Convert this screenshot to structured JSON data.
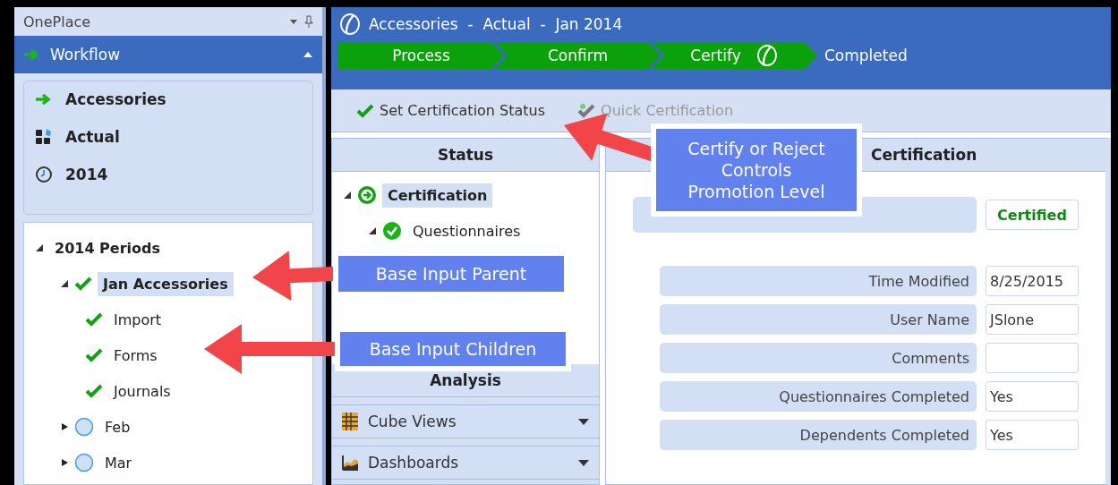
{
  "sidebar": {
    "title": "OnePlace",
    "workflow": {
      "label": "Workflow",
      "expanded": true
    },
    "pov": [
      {
        "kind": "workflow",
        "label": "Accessories"
      },
      {
        "kind": "scenario",
        "label": "Actual"
      },
      {
        "kind": "time",
        "label": "2014"
      }
    ],
    "periods": [
      {
        "label": "2014 Periods",
        "expanded": true,
        "selected": false,
        "children": [
          {
            "label": "Jan Accessories",
            "complete": true,
            "expanded": true,
            "selected": true,
            "children": [
              {
                "label": "Import",
                "complete": true,
                "selected": false
              },
              {
                "label": "Forms",
                "complete": true,
                "selected": false
              },
              {
                "label": "Journals",
                "complete": true,
                "selected": false
              }
            ]
          },
          {
            "label": "Feb",
            "complete": false,
            "expanded": false,
            "selected": false
          },
          {
            "label": "Mar",
            "complete": false,
            "expanded": false,
            "selected": false
          }
        ]
      }
    ]
  },
  "header": {
    "title": "Accessories  -  Actual  -  Jan 2014",
    "steps": [
      {
        "label": "Process",
        "done": true,
        "current": false
      },
      {
        "label": "Confirm",
        "done": true,
        "current": false
      },
      {
        "label": "Certify",
        "done": true,
        "current": true
      },
      {
        "label": "Completed",
        "done": false,
        "current": false
      }
    ]
  },
  "toolbar": [
    {
      "label": "Set Certification Status",
      "disabled": false
    },
    {
      "label": "Quick Certification",
      "disabled": true
    }
  ],
  "status_panel": {
    "title": "Status",
    "tree": [
      {
        "label": "Certification",
        "complete": false,
        "expanded": true,
        "selected": true,
        "children": [
          {
            "label": "Questionnaires",
            "complete": true,
            "expanded": true,
            "selected": false
          }
        ]
      }
    ]
  },
  "analysis": {
    "title": "Analysis",
    "items": [
      {
        "kind": "cube",
        "label": "Cube Views",
        "expanded": false
      },
      {
        "kind": "dashboard",
        "label": "Dashboards",
        "expanded": false
      }
    ]
  },
  "certification": {
    "title": "Certification",
    "fields": [
      {
        "kind": "status",
        "value": "Certified"
      },
      {
        "kind": "text",
        "label": "Time Modified",
        "value": "8/25/2015"
      },
      {
        "kind": "text",
        "label": "User Name",
        "value": "JSlone"
      },
      {
        "kind": "text",
        "label": "Comments"
      },
      {
        "kind": "text",
        "label": "Questionnaires Completed",
        "value": "Yes"
      },
      {
        "kind": "text",
        "label": "Dependents Completed",
        "value": "Yes"
      }
    ]
  },
  "callouts": [
    {
      "text": "Certify or Reject Controls Promotion Level"
    },
    {
      "text": "Base Input Parent"
    },
    {
      "text": "Base Input Children"
    }
  ]
}
